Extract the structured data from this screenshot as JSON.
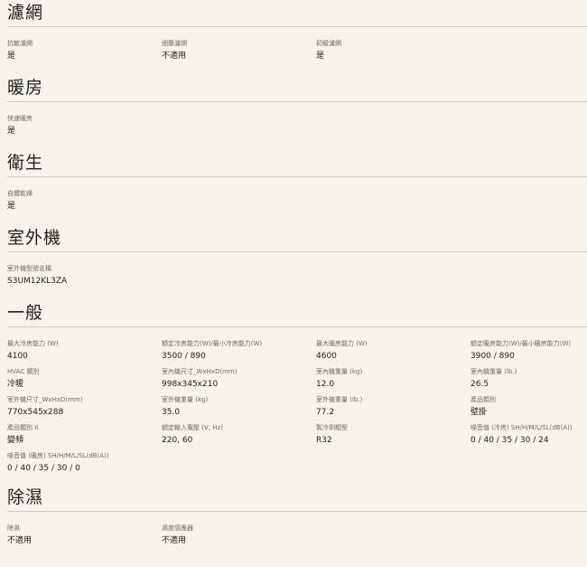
{
  "sections": [
    {
      "title": "濾網",
      "rows": [
        [
          {
            "label": "抗敏濾網",
            "value": "是"
          },
          {
            "label": "細塵濾網",
            "value": "不適用"
          },
          {
            "label": "初級濾網",
            "value": "是"
          }
        ]
      ]
    },
    {
      "title": "暖房",
      "rows": [
        [
          {
            "label": "快速暖房",
            "value": "是"
          }
        ]
      ]
    },
    {
      "title": "衛生",
      "rows": [
        [
          {
            "label": "自體乾燥",
            "value": "是"
          }
        ]
      ]
    },
    {
      "title": "室外機",
      "rows": [
        [
          {
            "label": "室外機型號名稱",
            "value": "S3UM12KL3ZA"
          }
        ]
      ]
    },
    {
      "title": "一般",
      "rows": [
        [
          {
            "label": "最大冷房能力 (W)",
            "value": "4100"
          },
          {
            "label": "額定冷房能力(W)/最小冷房能力(W)",
            "value": "3500 / 890"
          },
          {
            "label": "最大暖房能力 (W)",
            "value": "4600"
          },
          {
            "label": "額定暖房能力(W)/最小暖房能力(W)",
            "value": "3900 / 890"
          }
        ],
        [
          {
            "label": "HVAC 類別",
            "value": "冷暖"
          },
          {
            "label": "室內機尺寸_WxHxD(mm)",
            "value": "998x345x210"
          },
          {
            "label": "室內機重量 (kg)",
            "value": "12.0"
          },
          {
            "label": "室內機重量 (lb.)",
            "value": "26.5"
          }
        ],
        [
          {
            "label": "室外機尺寸_WxHxD(mm)",
            "value": "770x545x288"
          },
          {
            "label": "室外機重量 (kg)",
            "value": "35.0"
          },
          {
            "label": "室外機重量 (lb.)",
            "value": "77.2"
          },
          {
            "label": "產品類別",
            "value": "壁掛"
          }
        ],
        [
          {
            "label": "產品類別 II",
            "value": "變頻"
          },
          {
            "label": "額定輸入電壓 (V, Hz)",
            "value": "220, 60"
          },
          {
            "label": "製冷劑類型",
            "value": "R32"
          },
          {
            "label": "噪音值 (冷房) SH/H/M/L/SL(dB(A))",
            "value": "0 / 40 / 35 / 30 / 24"
          }
        ],
        [
          {
            "label": "噪音值 (暖房) SH/H/M/L/SL(dB(A))",
            "value": "0 / 40 / 35 / 30 / 0"
          }
        ]
      ]
    },
    {
      "title": "除濕",
      "rows": [
        [
          {
            "label": "除濕",
            "value": "不適用"
          },
          {
            "label": "濕度感應器",
            "value": "不適用"
          }
        ]
      ]
    }
  ]
}
